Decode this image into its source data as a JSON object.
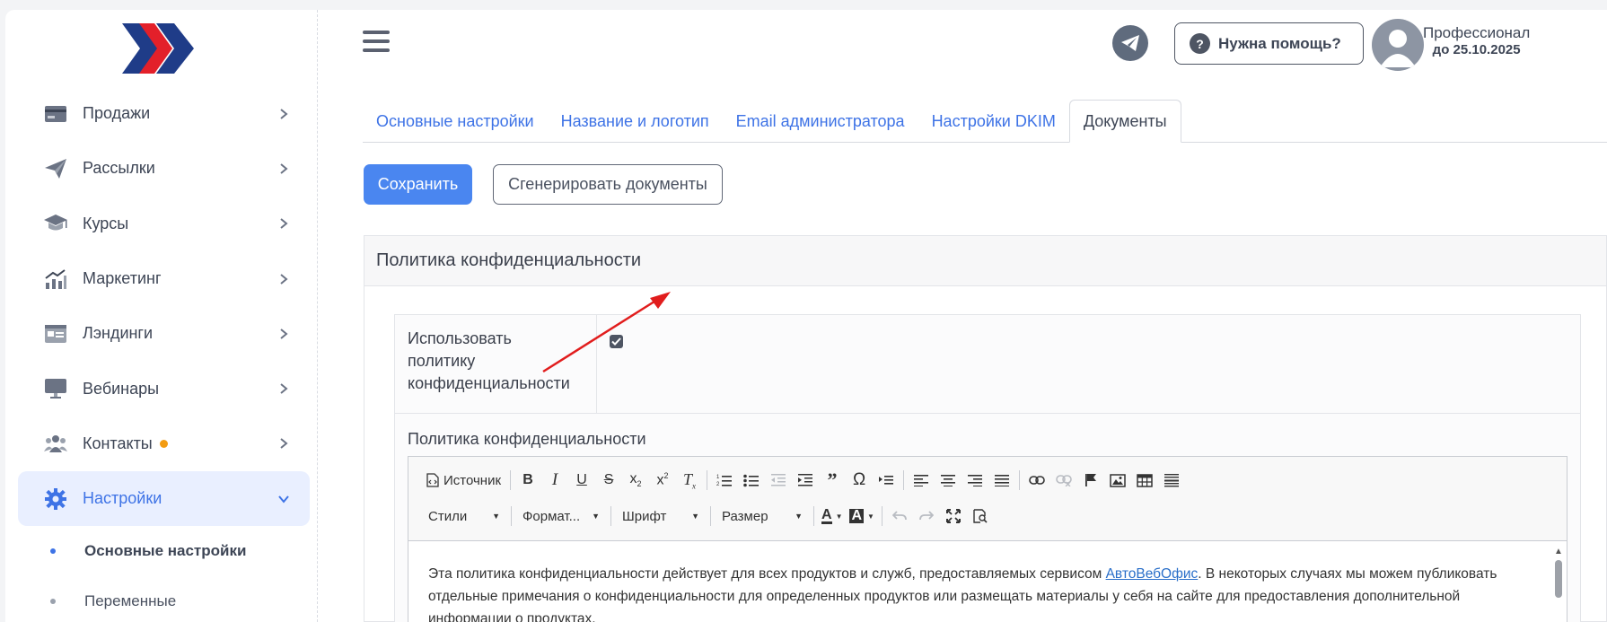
{
  "sidebar": {
    "items": [
      {
        "label": "Продажи",
        "icon": "credit-card-icon"
      },
      {
        "label": "Рассылки",
        "icon": "paper-plane-icon"
      },
      {
        "label": "Курсы",
        "icon": "graduation-cap-icon"
      },
      {
        "label": "Маркетинг",
        "icon": "chart-growth-icon"
      },
      {
        "label": "Лэндинги",
        "icon": "landing-page-icon"
      },
      {
        "label": "Вебинары",
        "icon": "monitor-icon"
      },
      {
        "label": "Контакты",
        "icon": "users-icon",
        "badge_color": "#f39c12"
      },
      {
        "label": "Настройки",
        "icon": "gear-icon",
        "active": true
      }
    ],
    "sub_items": [
      {
        "label": "Основные настройки",
        "active": true
      },
      {
        "label": "Переменные",
        "active": false
      }
    ]
  },
  "header": {
    "help_label": "Нужна помощь?",
    "help_icon": "?",
    "plan_name": "Профессионал",
    "plan_until": "до 25.10.2025"
  },
  "tabs": [
    {
      "label": "Основные настройки"
    },
    {
      "label": "Название и логотип"
    },
    {
      "label": "Email администратора"
    },
    {
      "label": "Настройки DKIM"
    },
    {
      "label": "Документы",
      "active": true
    }
  ],
  "actions": {
    "save_label": "Сохранить",
    "generate_label": "Сгенерировать документы"
  },
  "panel": {
    "title": "Политика конфиденциальности",
    "use_policy_label": "Использовать политику конфиденциальности",
    "use_policy_checked": true,
    "editor_label": "Политика конфиденциальности"
  },
  "editor": {
    "source_label": "Источник",
    "styles_label": "Стили",
    "format_label": "Формат...",
    "font_label": "Шрифт",
    "size_label": "Размер",
    "text_before_link": "Эта политика конфиденциальности действует для всех продуктов и служб, предоставляемых сервисом ",
    "link_text": "АвтоВебОфис",
    "text_after_link": ". В некоторых случаях мы можем публиковать отдельные примечания о конфиденциальности для определенных продуктов или размещать материалы у себя на сайте для предоставления дополнительной информации о продуктах."
  },
  "colors": {
    "accent": "#3e73e6",
    "save_button": "#4a86f0",
    "brand_blue": "#1f3c88",
    "brand_red": "#e3202a",
    "badge": "#f39c12"
  }
}
